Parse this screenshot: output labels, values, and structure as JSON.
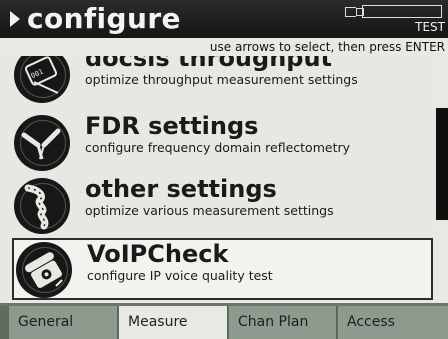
{
  "header": {
    "title": "configure",
    "test_label": "TEST",
    "hint": "use arrows to select, then press ENTER"
  },
  "menu": {
    "items": [
      {
        "label": "docsis throughput",
        "description": "optimize throughput measurement settings",
        "icon": "cable-icon"
      },
      {
        "label": "FDR settings",
        "description": "configure frequency domain reflectometry",
        "icon": "broken-cable-icon"
      },
      {
        "label": "other settings",
        "description": "optimize various measurement settings",
        "icon": "coiled-cable-icon"
      },
      {
        "label": "VoIPCheck",
        "description": "configure IP voice quality test",
        "icon": "telephone-icon"
      }
    ],
    "selected_index": 3
  },
  "tabs": [
    "General",
    "Measure",
    "Chan Plan",
    "Access"
  ],
  "active_tab": "Measure",
  "colors": {
    "titlebar": "#1a1a1a",
    "panel": "#e8e8e2",
    "tab_inactive": "#8e9a8e",
    "tab_active": "#e9e9e3"
  }
}
